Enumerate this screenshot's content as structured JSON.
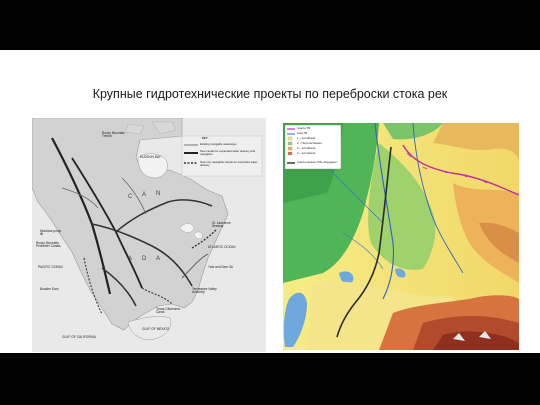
{
  "slide": {
    "title": "Крупные гидротехнические проекты по переброски стока рек"
  },
  "left_map": {
    "labels": {
      "hudson_bay": "HUDSON BAY",
      "rocky_mountain_trench": "Rocky Mountain Trench",
      "canada_letters": [
        "C",
        "A",
        "N",
        "A",
        "D",
        "A"
      ],
      "st_lawrence": "St. Lawrence Seaway",
      "atlantic": "ATLANTIC OCEAN",
      "pacific": "PACIFIC OCEAN",
      "montana_pump": "Montana pump lift",
      "rocky_perimeter": "Rocky Mountain Perimeter Canals",
      "boulder_dam": "Boulder Dam",
      "gulf_california": "GULF OF CALIFORNIA",
      "gulf_mexico": "GULF OF MEXICO",
      "texas_oklahoma": "Texas-Oklahoma Canal",
      "tennessee": "Tennessee Valley Authority",
      "york_andrew": "York and Dem 3A"
    },
    "key": {
      "title": "KEY",
      "items": [
        "Existing navigable waterways",
        "New canals for expanded water delivery and navigation",
        "New non-navigable canals for expanded water delivery"
      ]
    }
  },
  "right_map": {
    "legend": [
      "трасса ТВ",
      "зона ТВ",
      "1 – Алтайская",
      "2 – Перспективная",
      "3 – Алтайская",
      "4 – Алтайская",
      "трасса канала \"Обь-Амударья\""
    ]
  }
}
